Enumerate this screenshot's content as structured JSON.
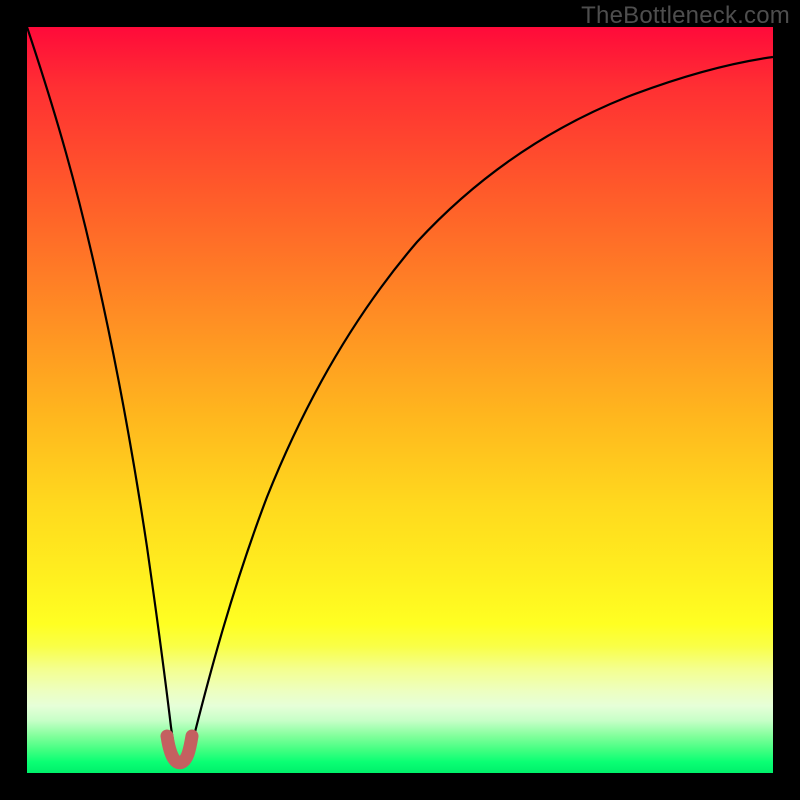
{
  "watermark": "TheBottleneck.com",
  "chart_data": {
    "type": "line",
    "title": "",
    "xlabel": "",
    "ylabel": "",
    "xlim": [
      0,
      100
    ],
    "ylim": [
      0,
      100
    ],
    "grid": false,
    "series": [
      {
        "name": "bottleneck-curve",
        "x": [
          0,
          4,
          8,
          12,
          15,
          17,
          18.5,
          19.3,
          20.1,
          21,
          23,
          26,
          30,
          36,
          44,
          54,
          66,
          80,
          94,
          100
        ],
        "values": [
          100,
          82,
          64,
          46,
          30,
          18,
          9,
          3,
          1,
          3,
          12,
          25,
          40,
          55,
          68,
          78,
          85,
          89.5,
          91.5,
          92
        ]
      },
      {
        "name": "trough-marker",
        "x": [
          18.6,
          19.0,
          19.5,
          20.0,
          20.5,
          20.9
        ],
        "values": [
          4.2,
          2.6,
          1.8,
          1.8,
          2.6,
          4.2
        ]
      }
    ],
    "colors": {
      "curve": "#000000",
      "marker": "#c46060",
      "gradient_top": "#ff0a3a",
      "gradient_bottom": "#00f06a"
    }
  }
}
